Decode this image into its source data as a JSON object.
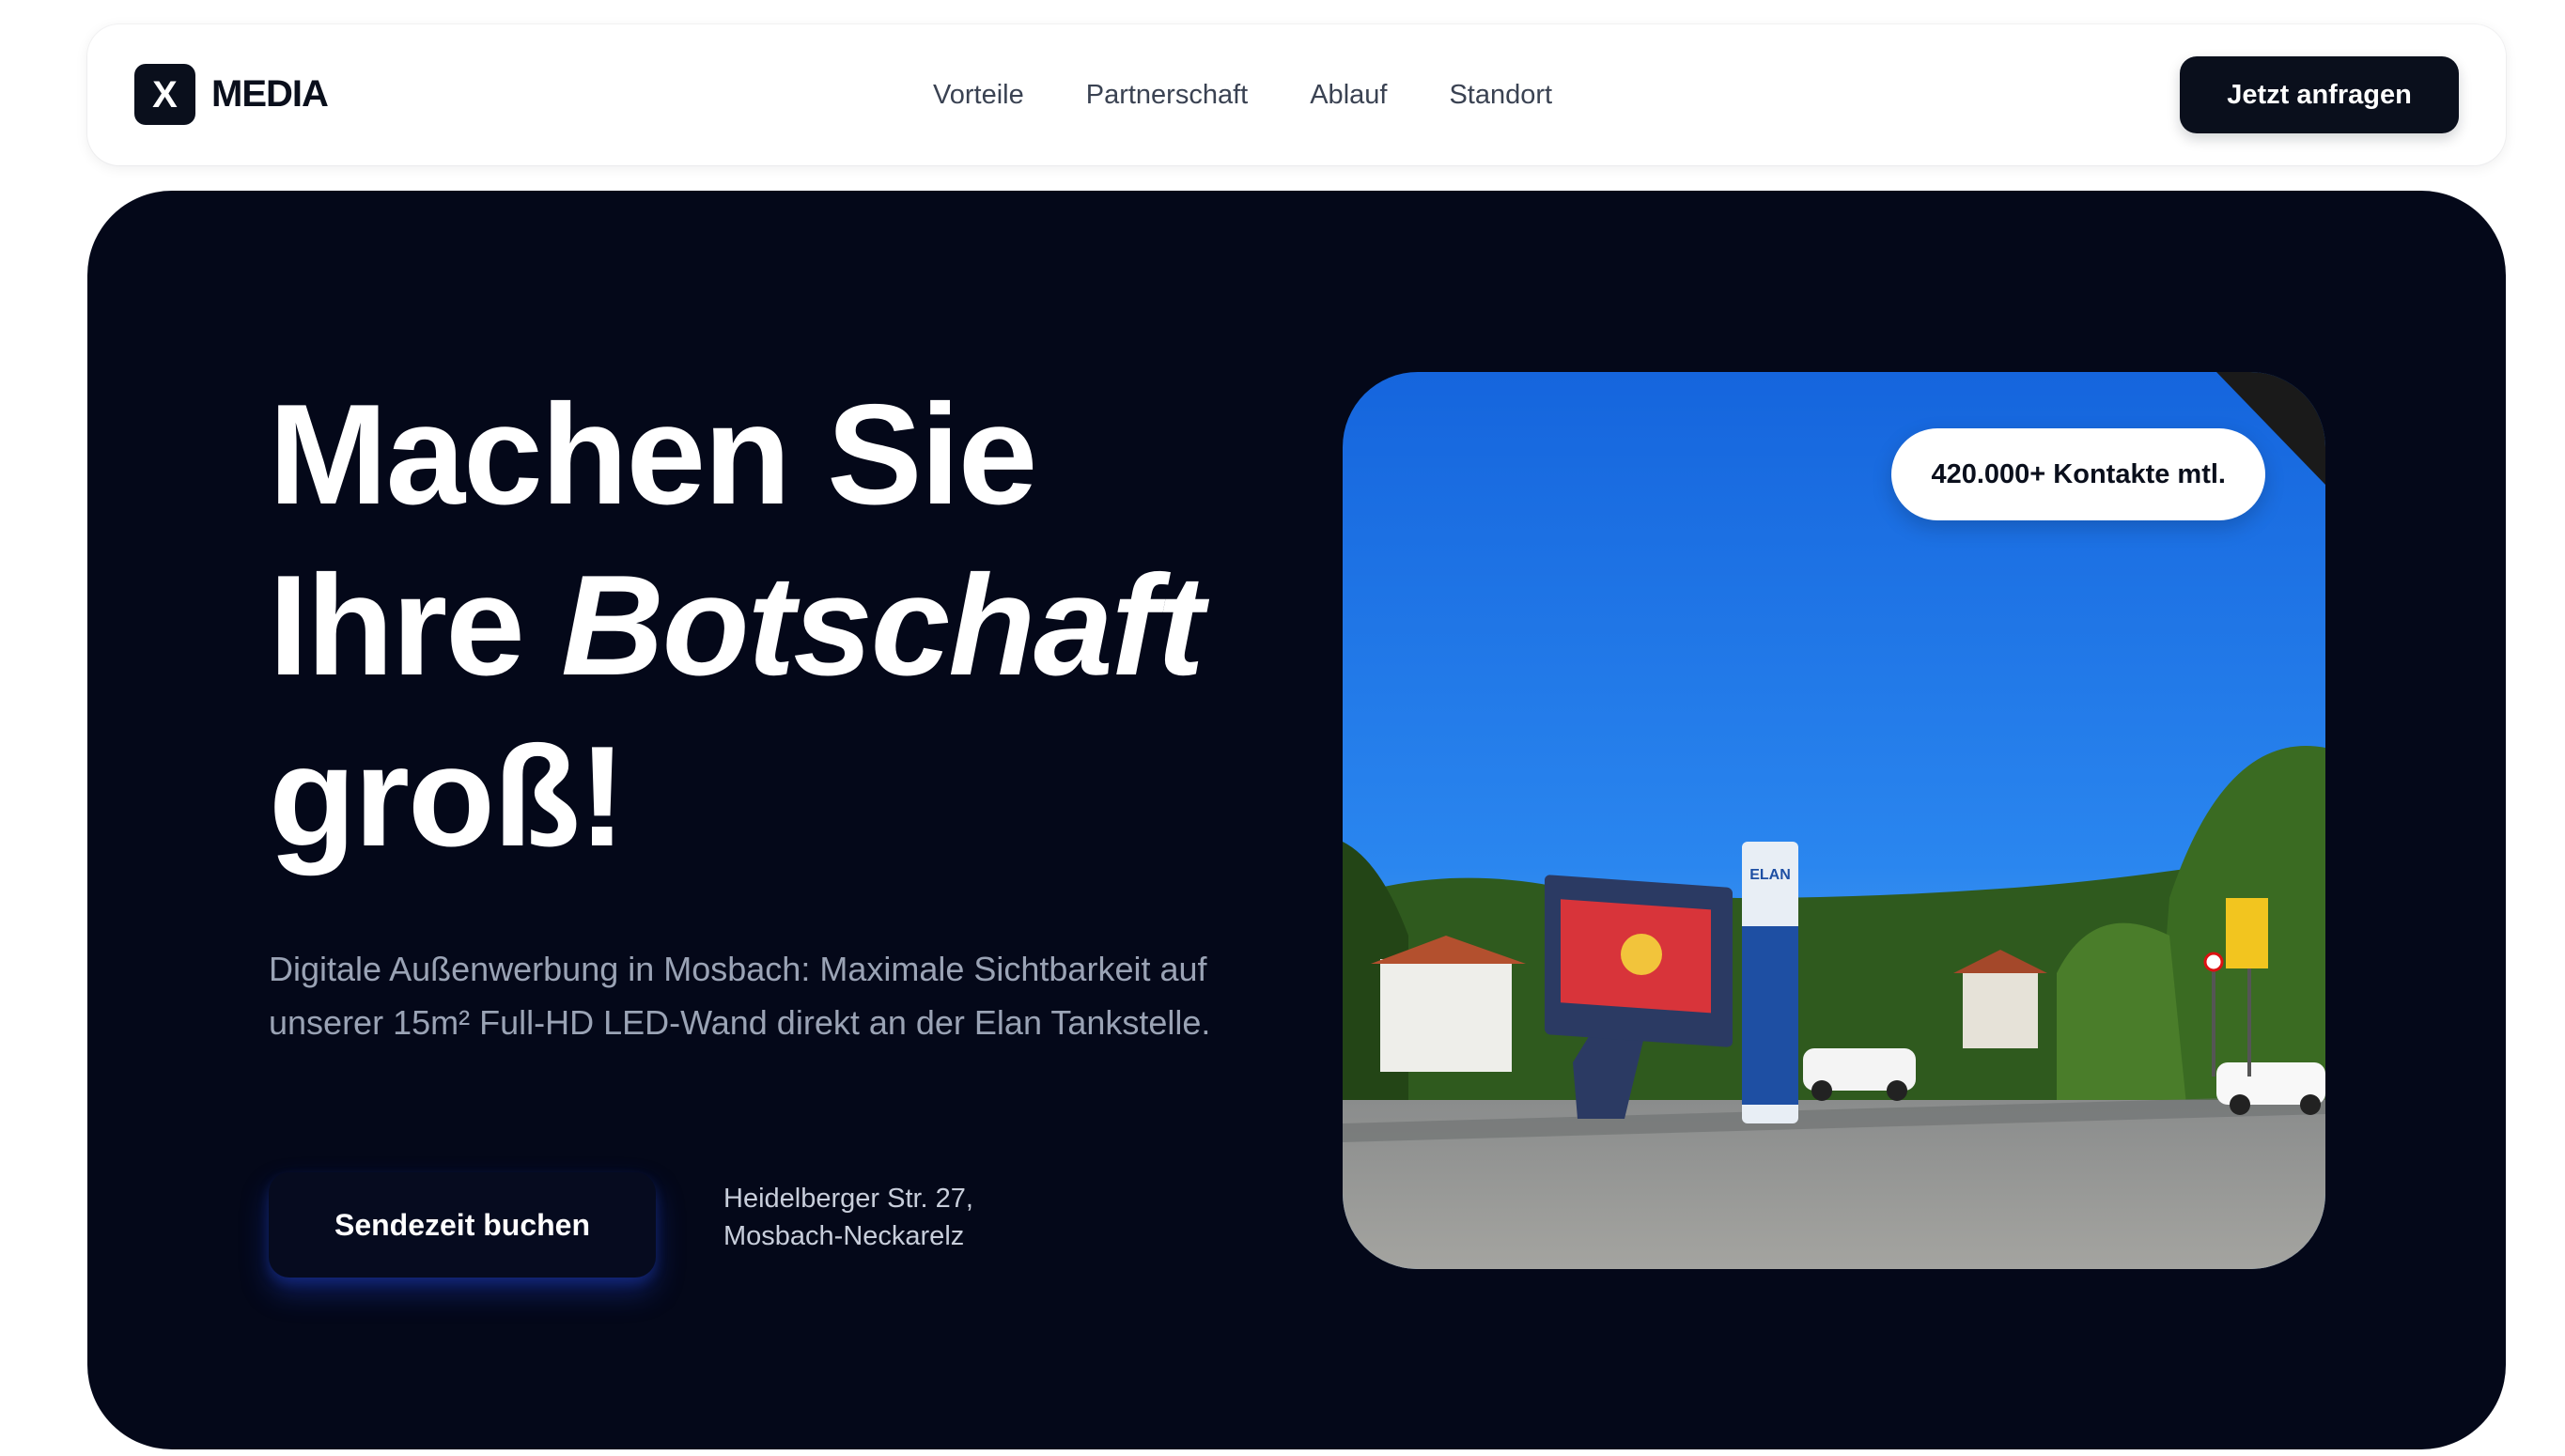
{
  "brand": {
    "mark": "X",
    "name": "MEDIA"
  },
  "nav": {
    "links": [
      "Vorteile",
      "Partnerschaft",
      "Ablauf",
      "Standort"
    ],
    "cta": "Jetzt anfragen"
  },
  "hero": {
    "headline": {
      "line1": "Machen Sie",
      "line2_plain": "Ihre ",
      "line2_italic": "Botschaft",
      "line3": "groß!"
    },
    "description": "Digitale Außenwerbung in Mosbach: Maximale Sichtbarkeit auf unserer 15m² Full-HD LED-Wand direkt an der Elan Tankstelle.",
    "cta": "Sendezeit buchen",
    "address": {
      "street": "Heidelberger Str. 27,",
      "city": "Mosbach-Neckarelz"
    },
    "image": {
      "badge": "420.000+ Kontakte mtl.",
      "sign_text": "ELAN"
    }
  },
  "colors": {
    "dark": "#040819",
    "brand_dark": "#0a0f1c",
    "cta_glow": "#2346dc"
  }
}
